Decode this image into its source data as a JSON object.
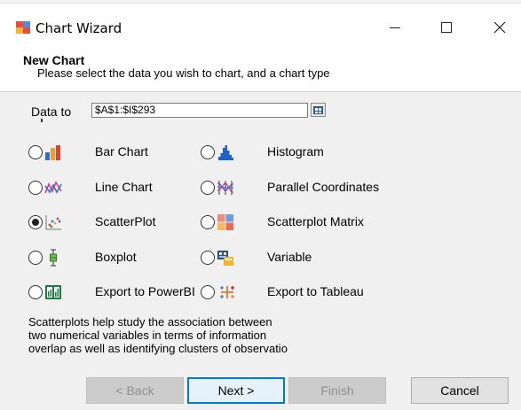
{
  "window": {
    "title": "Chart Wizard",
    "minimize_glyph": "",
    "maximize_glyph": "",
    "close_glyph": "✕"
  },
  "header": {
    "title": "New Chart",
    "subtitle": "Please select the data you wish to chart, and a chart type"
  },
  "data_range": {
    "label": "Data to",
    "value": "$A$1:$I$293"
  },
  "chart_types": {
    "bar": {
      "label": "Bar Chart",
      "selected": false,
      "icon": "bar-chart-icon"
    },
    "line": {
      "label": "Line Chart",
      "selected": false,
      "icon": "line-chart-icon"
    },
    "scatter": {
      "label": "ScatterPlot",
      "selected": true,
      "icon": "scatter-plot-icon"
    },
    "boxplot": {
      "label": "Boxplot",
      "selected": false,
      "icon": "boxplot-icon"
    },
    "powerbi": {
      "label": "Export to PowerBI",
      "selected": false,
      "icon": "powerbi-icon"
    },
    "histogram": {
      "label": "Histogram",
      "selected": false,
      "icon": "histogram-icon"
    },
    "parallel": {
      "label": "Parallel Coordinates",
      "selected": false,
      "icon": "parallel-coordinates-icon"
    },
    "matrix": {
      "label": "Scatterplot Matrix",
      "selected": false,
      "icon": "scatterplot-matrix-icon"
    },
    "variable": {
      "label": "Variable",
      "selected": false,
      "icon": "variable-icon"
    },
    "tableau": {
      "label": "Export to Tableau",
      "selected": false,
      "icon": "tableau-icon"
    }
  },
  "description": {
    "line1": "Scatterplots help study the association between",
    "line2": "two numerical variables in terms of information",
    "line3": "overlap as well as identifying clusters of observatio"
  },
  "footer": {
    "back_label": "< Back",
    "next_label": "Next >",
    "finish_label": "Finish",
    "cancel_label": "Cancel"
  },
  "colors": {
    "accent": "#0078d7",
    "dialog_bg": "#f0f0f0"
  }
}
